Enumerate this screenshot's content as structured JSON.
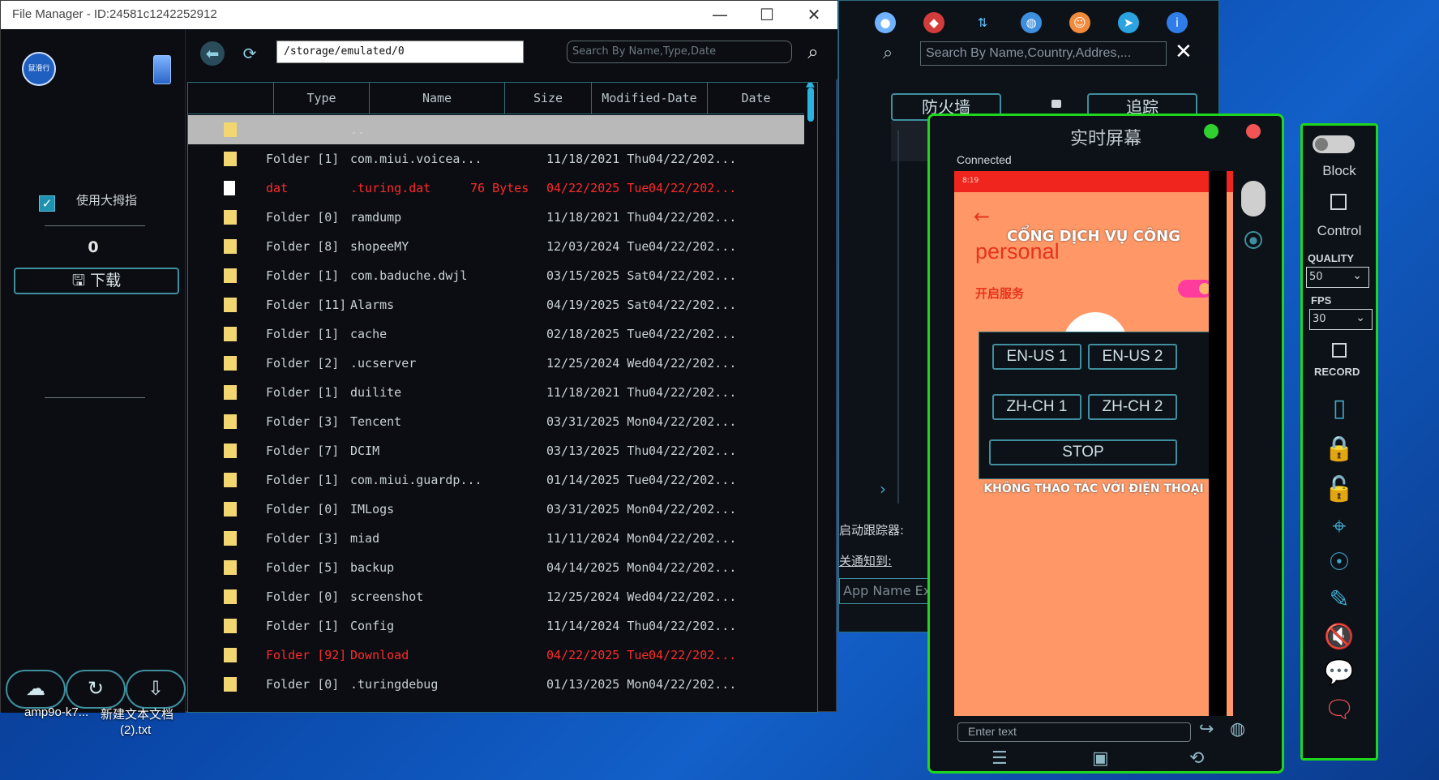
{
  "file_manager": {
    "title": "File Manager - ID:24581c1242252912",
    "window_controls": {
      "minimize": "—",
      "maximize": "☐",
      "close": "✕"
    },
    "left_panel": {
      "logo_text": "鼠滑行",
      "checkbox_label": "使用大拇指",
      "checkbox_mark": "✓",
      "count": "0",
      "download_label": "🖫 下载",
      "bottom_buttons": [
        "☁",
        "↻",
        "⇩"
      ]
    },
    "toolbar": {
      "back_icon": "⬅",
      "refresh_icon": "⟳",
      "path": "/storage/emulated/0",
      "search_placeholder": "Search By Name,Type,Date",
      "search_icon": "⌕"
    },
    "table": {
      "columns": [
        "Type",
        "Name",
        "Size",
        "Modified-Date",
        "Date"
      ],
      "rows": [
        {
          "type": "",
          "name": "..",
          "size": "",
          "modified": "",
          "date": "",
          "kind": "folder",
          "selected": true,
          "red": false
        },
        {
          "type": "Folder [1]",
          "name": "com.miui.voicea...",
          "size": "",
          "modified": "11/18/2021 Thu",
          "date": "04/22/202...",
          "kind": "folder",
          "selected": false,
          "red": false
        },
        {
          "type": "dat",
          "name": ".turing.dat",
          "size": "76 Bytes",
          "modified": "04/22/2025 Tue",
          "date": "04/22/202...",
          "kind": "file",
          "selected": false,
          "red": true
        },
        {
          "type": "Folder [0]",
          "name": "ramdump",
          "size": "",
          "modified": "11/18/2021 Thu",
          "date": "04/22/202...",
          "kind": "folder",
          "selected": false,
          "red": false
        },
        {
          "type": "Folder [8]",
          "name": "shopeeMY",
          "size": "",
          "modified": "12/03/2024 Tue",
          "date": "04/22/202...",
          "kind": "folder",
          "selected": false,
          "red": false
        },
        {
          "type": "Folder [1]",
          "name": "com.baduche.dwjl",
          "size": "",
          "modified": "03/15/2025 Sat",
          "date": "04/22/202...",
          "kind": "folder",
          "selected": false,
          "red": false
        },
        {
          "type": "Folder [11]",
          "name": "Alarms",
          "size": "",
          "modified": "04/19/2025 Sat",
          "date": "04/22/202...",
          "kind": "folder",
          "selected": false,
          "red": false
        },
        {
          "type": "Folder [1]",
          "name": "cache",
          "size": "",
          "modified": "02/18/2025 Tue",
          "date": "04/22/202...",
          "kind": "folder",
          "selected": false,
          "red": false
        },
        {
          "type": "Folder [2]",
          "name": ".ucserver",
          "size": "",
          "modified": "12/25/2024 Wed",
          "date": "04/22/202...",
          "kind": "folder",
          "selected": false,
          "red": false
        },
        {
          "type": "Folder [1]",
          "name": "duilite",
          "size": "",
          "modified": "11/18/2021 Thu",
          "date": "04/22/202...",
          "kind": "folder",
          "selected": false,
          "red": false
        },
        {
          "type": "Folder [3]",
          "name": "Tencent",
          "size": "",
          "modified": "03/31/2025 Mon",
          "date": "04/22/202...",
          "kind": "folder",
          "selected": false,
          "red": false
        },
        {
          "type": "Folder [7]",
          "name": "DCIM",
          "size": "",
          "modified": "03/13/2025 Thu",
          "date": "04/22/202...",
          "kind": "folder",
          "selected": false,
          "red": false
        },
        {
          "type": "Folder [1]",
          "name": "com.miui.guardp...",
          "size": "",
          "modified": "01/14/2025 Tue",
          "date": "04/22/202...",
          "kind": "folder",
          "selected": false,
          "red": false
        },
        {
          "type": "Folder [0]",
          "name": "IMLogs",
          "size": "",
          "modified": "03/31/2025 Mon",
          "date": "04/22/202...",
          "kind": "folder",
          "selected": false,
          "red": false
        },
        {
          "type": "Folder [3]",
          "name": "miad",
          "size": "",
          "modified": "11/11/2024 Mon",
          "date": "04/22/202...",
          "kind": "folder",
          "selected": false,
          "red": false
        },
        {
          "type": "Folder [5]",
          "name": "backup",
          "size": "",
          "modified": "04/14/2025 Mon",
          "date": "04/22/202...",
          "kind": "folder",
          "selected": false,
          "red": false
        },
        {
          "type": "Folder [0]",
          "name": "screenshot",
          "size": "",
          "modified": "12/25/2024 Wed",
          "date": "04/22/202...",
          "kind": "folder",
          "selected": false,
          "red": false
        },
        {
          "type": "Folder [1]",
          "name": "Config",
          "size": "",
          "modified": "11/14/2024 Thu",
          "date": "04/22/202...",
          "kind": "folder",
          "selected": false,
          "red": false
        },
        {
          "type": "Folder [92]",
          "name": "Download",
          "size": "",
          "modified": "04/22/2025 Tue",
          "date": "04/22/202...",
          "kind": "folder",
          "selected": false,
          "red": true
        },
        {
          "type": "Folder [0]",
          "name": ".turingdebug",
          "size": "",
          "modified": "01/13/2025 Mon",
          "date": "04/22/202...",
          "kind": "folder",
          "selected": false,
          "red": false
        }
      ]
    }
  },
  "background_app": {
    "search_placeholder": "Search By Name,Country,Addres,...",
    "close_icon": "✕",
    "tabs": [
      "防火墙",
      "追踪"
    ],
    "labels": [
      "启动跟踪器:",
      "关通知到:"
    ],
    "app_name_placeholder": "App Name Ex",
    "arrow": "›"
  },
  "live_screen": {
    "title": "实时屏幕",
    "status": "Connected",
    "phone": {
      "status_text": "8:19",
      "back": "←",
      "heading": "CỔNG DỊCH VỤ CÔNG",
      "brand": "personal",
      "service_label": "开启服务",
      "warning": "KHÔNG THAO TÁC VỚI ĐIỆN THOẠI"
    },
    "overlay_buttons": [
      "EN-US 1",
      "EN-US 2",
      "ZH-CH 1",
      "ZH-CH 2",
      "STOP"
    ],
    "input_placeholder": "Enter text",
    "nav_icons": [
      "☰",
      "▣",
      "⟲"
    ],
    "send_icon": "↪",
    "globe_icon": "◍"
  },
  "control_panel": {
    "block_label": "Block",
    "control_label": "Control",
    "quality_label": "QUALITY",
    "quality_value": "50",
    "fps_label": "FPS",
    "fps_value": "30",
    "record_label": "RECORD",
    "icons": [
      "▯",
      "🔒",
      "🔓",
      "⌖",
      "☉",
      "✎",
      "🔇",
      "💬",
      "🗨"
    ]
  },
  "desktop": {
    "file_label_1": "amp9o-k7...",
    "file_label_2": "新建文本文档",
    "file_label_3": "(2).txt"
  }
}
